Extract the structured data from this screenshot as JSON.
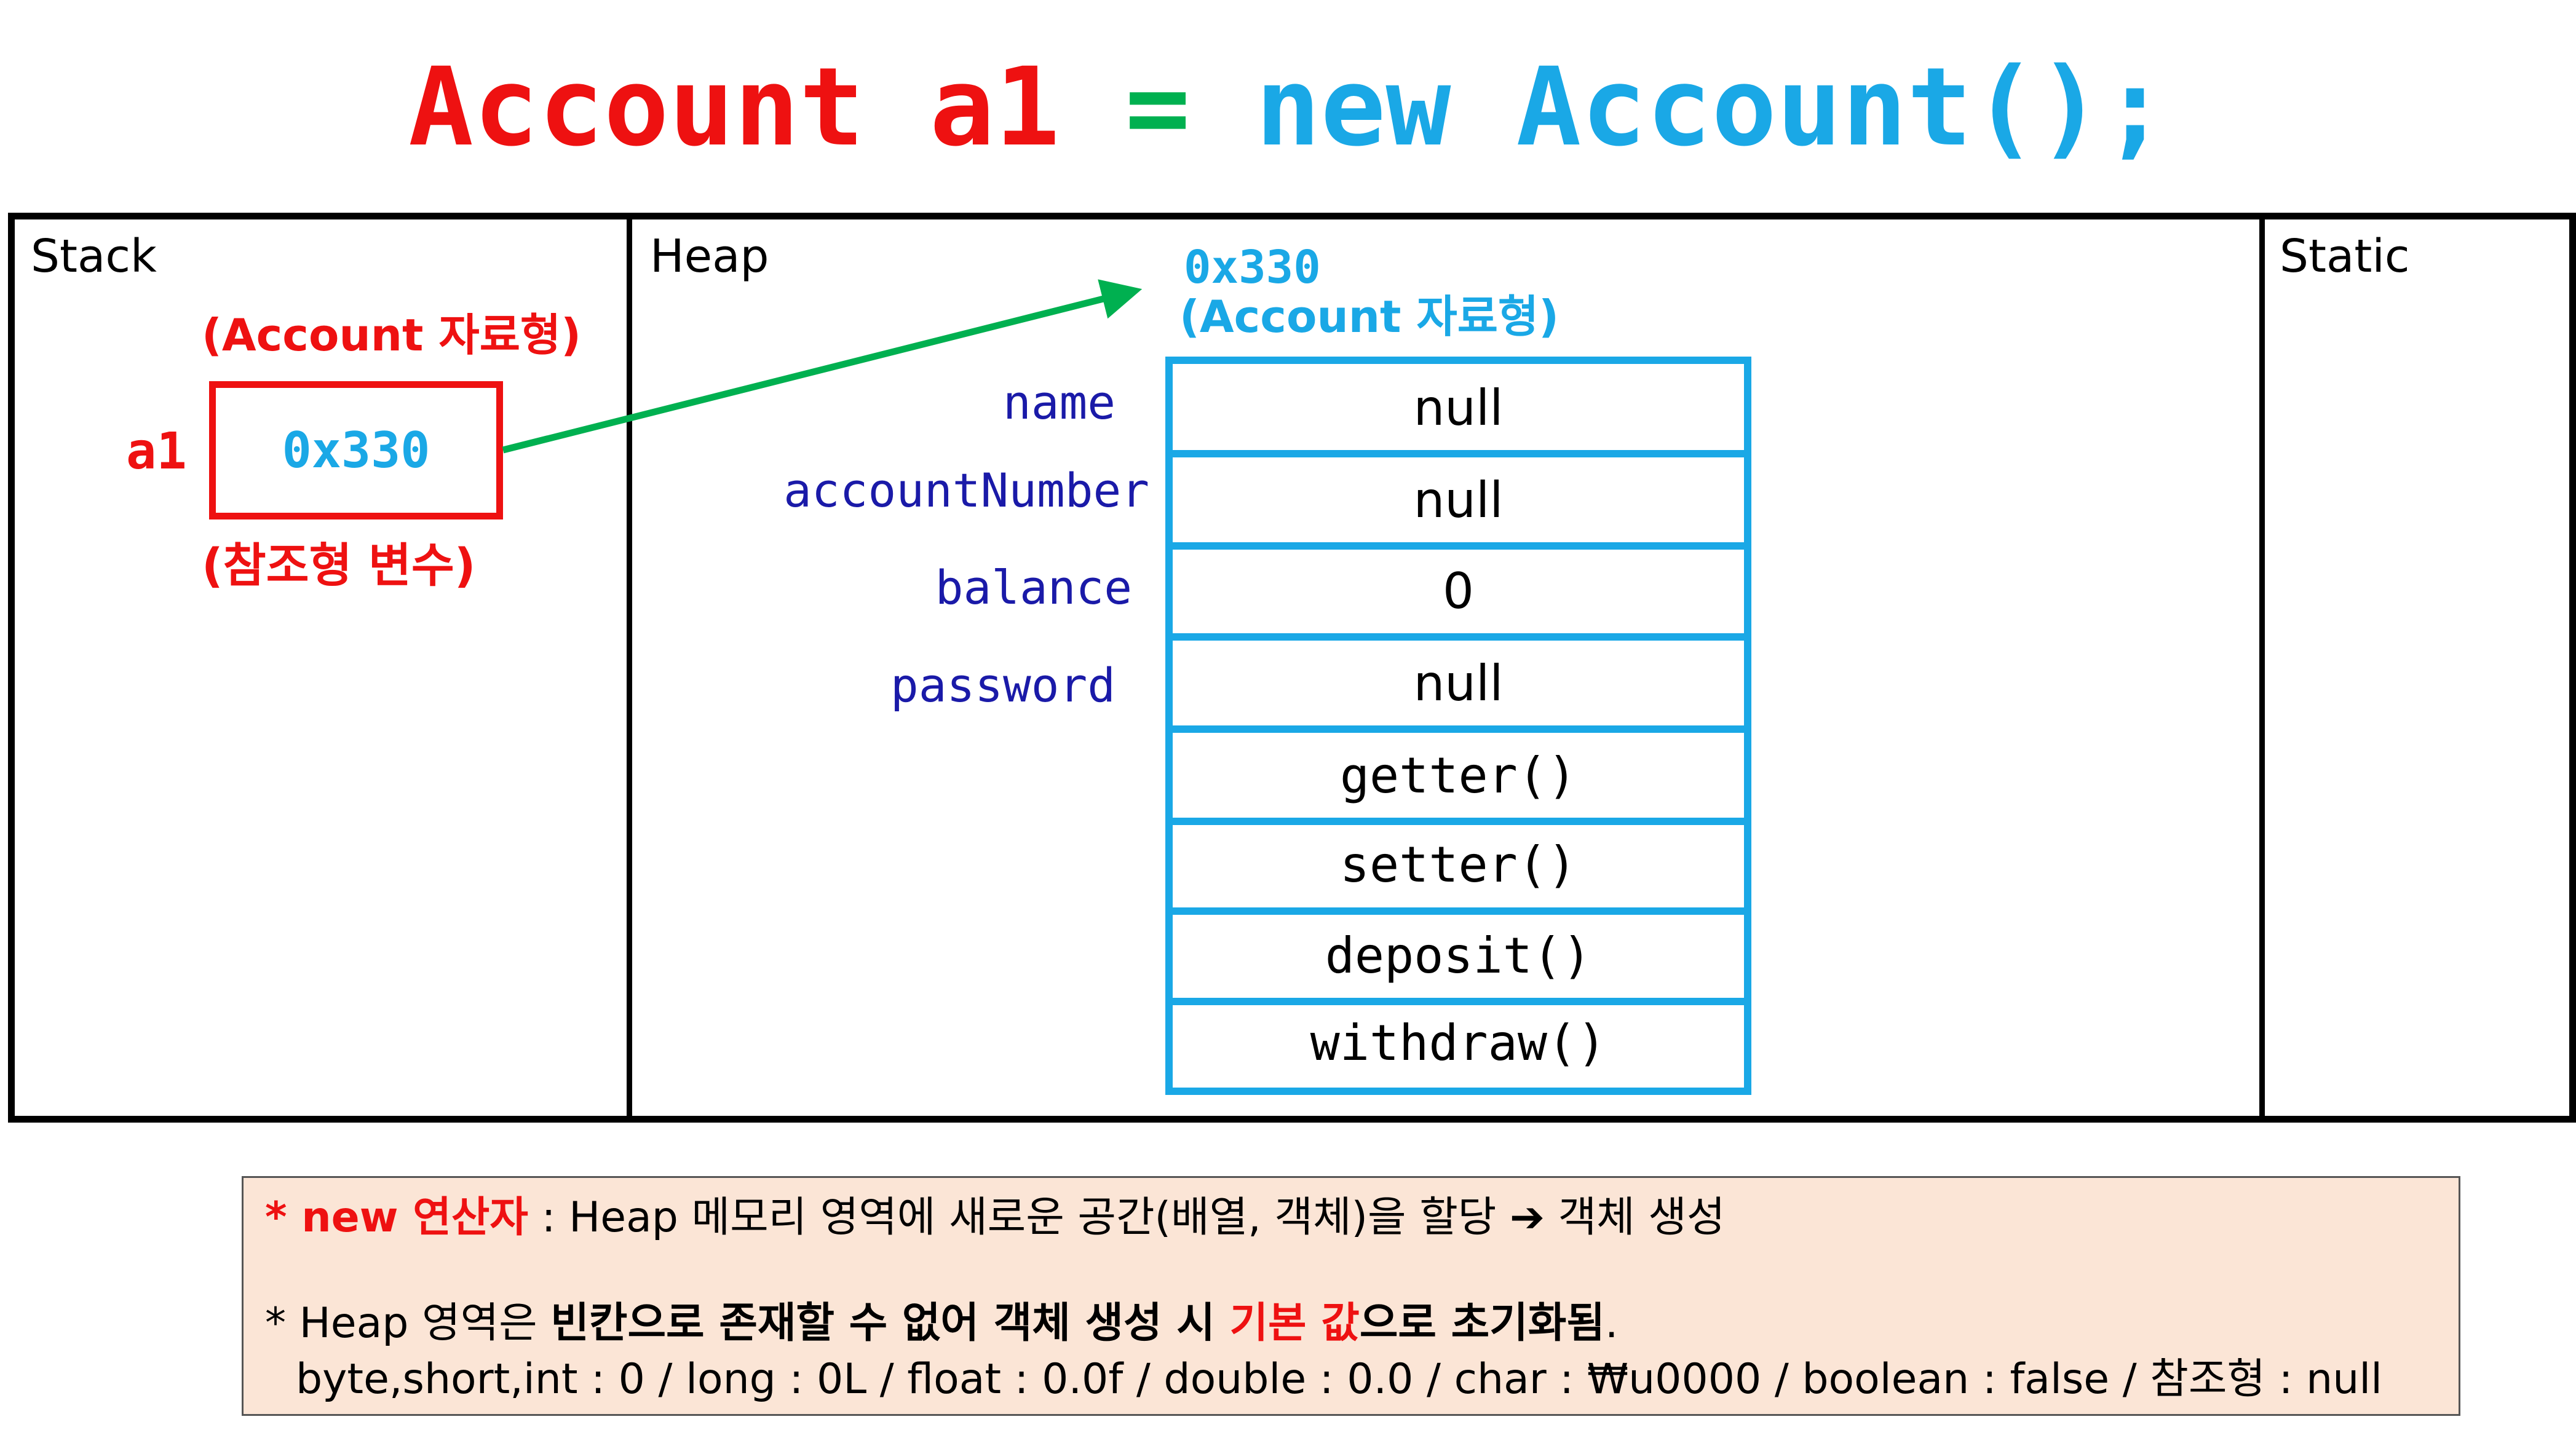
{
  "title": {
    "left": "Account a1",
    "equals": "=",
    "right": "new Account();",
    "colors": {
      "left": "#ee1111",
      "equals": "#00b050",
      "right": "#1aa8e6"
    }
  },
  "panels": {
    "stack": "Stack",
    "heap": "Heap",
    "static": "Static"
  },
  "stack": {
    "type_label": "(Account 자료형)",
    "var_name": "a1",
    "ref_value": "0x330",
    "kind_label": "(참조형 변수)"
  },
  "heap": {
    "address": "0x330",
    "type_label": "(Account 자료형)",
    "fields": [
      {
        "name": "name",
        "value": "null"
      },
      {
        "name": "accountNumber",
        "value": "null"
      },
      {
        "name": "balance",
        "value": "0"
      },
      {
        "name": "password",
        "value": "null"
      }
    ],
    "methods": [
      "getter()",
      "setter()",
      "deposit()",
      "withdraw()"
    ]
  },
  "note": {
    "line1": {
      "bullet": "* ",
      "keyword": "new 연산자",
      "text": " : Heap 메모리 영역에 새로운 공간(배열, 객체)을 할당 ",
      "arrow": "➔",
      "result": " 객체 생성"
    },
    "line2": {
      "prefix": "* Heap 영역은 ",
      "bold1": "빈칸으로 존재할 수 없어 객체 생성 시 ",
      "red": "기본 값",
      "bold2": "으로 초기화됨",
      "suffix": "."
    },
    "line3": "byte,short,int : 0 / long : 0L / float : 0.0f / double : 0.0 / char : ₩u0000 / boolean : false / 참조형 : null"
  },
  "colors": {
    "red": "#ee1111",
    "blue": "#1aa8e6",
    "navy": "#1a1aa8",
    "green": "#00b050",
    "note_bg": "#fbe5d6"
  }
}
